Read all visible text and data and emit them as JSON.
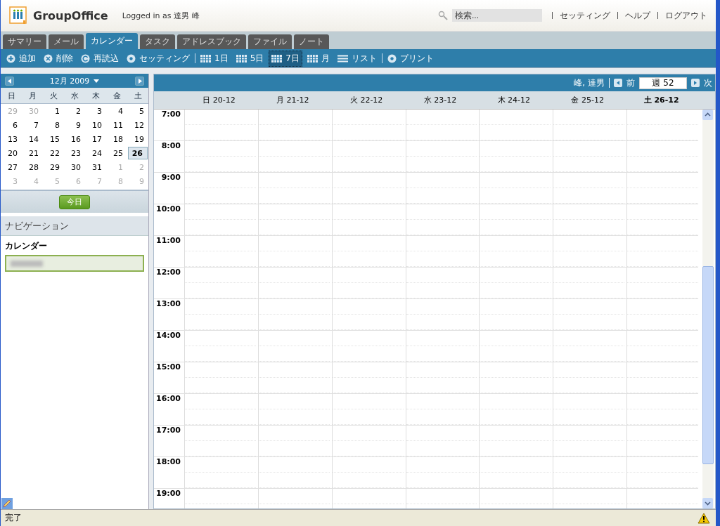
{
  "header": {
    "logo": "GroupOffice",
    "login": "Logged in as 達男 峰",
    "search": {
      "placeholder": "検索..."
    },
    "links": [
      "セッティング",
      "ヘルプ",
      "ログアウト"
    ]
  },
  "tabs": [
    {
      "label": "サマリー",
      "selected": false
    },
    {
      "label": "メール",
      "selected": false
    },
    {
      "label": "カレンダー",
      "selected": true
    },
    {
      "label": "タスク",
      "selected": false
    },
    {
      "label": "アドレスブック",
      "selected": false
    },
    {
      "label": "ファイル",
      "selected": false
    },
    {
      "label": "ノート",
      "selected": false
    }
  ],
  "toolbar": [
    {
      "kind": "add",
      "label": "追加",
      "selected": false
    },
    {
      "kind": "delete",
      "label": "削除",
      "selected": false
    },
    {
      "kind": "reload",
      "label": "再読込",
      "selected": false
    },
    {
      "kind": "settings",
      "label": "セッティング",
      "selected": false
    },
    {
      "kind": "sep"
    },
    {
      "kind": "grid",
      "label": "1日",
      "selected": false
    },
    {
      "kind": "grid",
      "label": "5日",
      "selected": false
    },
    {
      "kind": "grid",
      "label": "7日",
      "selected": true
    },
    {
      "kind": "grid",
      "label": "月",
      "selected": false
    },
    {
      "kind": "list",
      "label": "リスト",
      "selected": false
    },
    {
      "kind": "sep"
    },
    {
      "kind": "print",
      "label": "プリント",
      "selected": false
    }
  ],
  "mini_calendar": {
    "title": "12月 2009",
    "weekdays": [
      "日",
      "月",
      "火",
      "水",
      "木",
      "金",
      "土"
    ],
    "weeks": [
      [
        {
          "d": "29",
          "other": true,
          "selected": false
        },
        {
          "d": "30",
          "other": true,
          "selected": false
        },
        {
          "d": "1",
          "other": false,
          "selected": false
        },
        {
          "d": "2",
          "other": false,
          "selected": false
        },
        {
          "d": "3",
          "other": false,
          "selected": false
        },
        {
          "d": "4",
          "other": false,
          "selected": false
        },
        {
          "d": "5",
          "other": false,
          "selected": false
        }
      ],
      [
        {
          "d": "6",
          "other": false,
          "selected": false
        },
        {
          "d": "7",
          "other": false,
          "selected": false
        },
        {
          "d": "8",
          "other": false,
          "selected": false
        },
        {
          "d": "9",
          "other": false,
          "selected": false
        },
        {
          "d": "10",
          "other": false,
          "selected": false
        },
        {
          "d": "11",
          "other": false,
          "selected": false
        },
        {
          "d": "12",
          "other": false,
          "selected": false
        }
      ],
      [
        {
          "d": "13",
          "other": false,
          "selected": false
        },
        {
          "d": "14",
          "other": false,
          "selected": false
        },
        {
          "d": "15",
          "other": false,
          "selected": false
        },
        {
          "d": "16",
          "other": false,
          "selected": false
        },
        {
          "d": "17",
          "other": false,
          "selected": false
        },
        {
          "d": "18",
          "other": false,
          "selected": false
        },
        {
          "d": "19",
          "other": false,
          "selected": false
        }
      ],
      [
        {
          "d": "20",
          "other": false,
          "selected": false
        },
        {
          "d": "21",
          "other": false,
          "selected": false
        },
        {
          "d": "22",
          "other": false,
          "selected": false
        },
        {
          "d": "23",
          "other": false,
          "selected": false
        },
        {
          "d": "24",
          "other": false,
          "selected": false
        },
        {
          "d": "25",
          "other": false,
          "selected": false
        },
        {
          "d": "26",
          "other": false,
          "selected": true
        }
      ],
      [
        {
          "d": "27",
          "other": false,
          "selected": false
        },
        {
          "d": "28",
          "other": false,
          "selected": false
        },
        {
          "d": "29",
          "other": false,
          "selected": false
        },
        {
          "d": "30",
          "other": false,
          "selected": false
        },
        {
          "d": "31",
          "other": false,
          "selected": false
        },
        {
          "d": "1",
          "other": true,
          "selected": false
        },
        {
          "d": "2",
          "other": true,
          "selected": false
        }
      ],
      [
        {
          "d": "3",
          "other": true,
          "selected": false
        },
        {
          "d": "4",
          "other": true,
          "selected": false
        },
        {
          "d": "5",
          "other": true,
          "selected": false
        },
        {
          "d": "6",
          "other": true,
          "selected": false
        },
        {
          "d": "7",
          "other": true,
          "selected": false
        },
        {
          "d": "8",
          "other": true,
          "selected": false
        },
        {
          "d": "9",
          "other": true,
          "selected": false
        }
      ]
    ],
    "today_button": "今日"
  },
  "navigation": {
    "title": "ナビゲーション",
    "calendars_heading": "カレンダー"
  },
  "week_view": {
    "owner": "峰, 達男",
    "prev": "前",
    "week": "週 52",
    "next": "次",
    "days": [
      {
        "label": "日 20-12",
        "selected": false
      },
      {
        "label": "月 21-12",
        "selected": false
      },
      {
        "label": "火 22-12",
        "selected": false
      },
      {
        "label": "水 23-12",
        "selected": false
      },
      {
        "label": "木 24-12",
        "selected": false
      },
      {
        "label": "金 25-12",
        "selected": false
      },
      {
        "label": "土 26-12",
        "selected": true
      }
    ],
    "hours": [
      "7:00",
      "8:00",
      "9:00",
      "10:00",
      "11:00",
      "12:00",
      "13:00",
      "14:00",
      "15:00",
      "16:00",
      "17:00",
      "18:00",
      "19:00"
    ]
  },
  "status_bar": {
    "text": "完了"
  }
}
